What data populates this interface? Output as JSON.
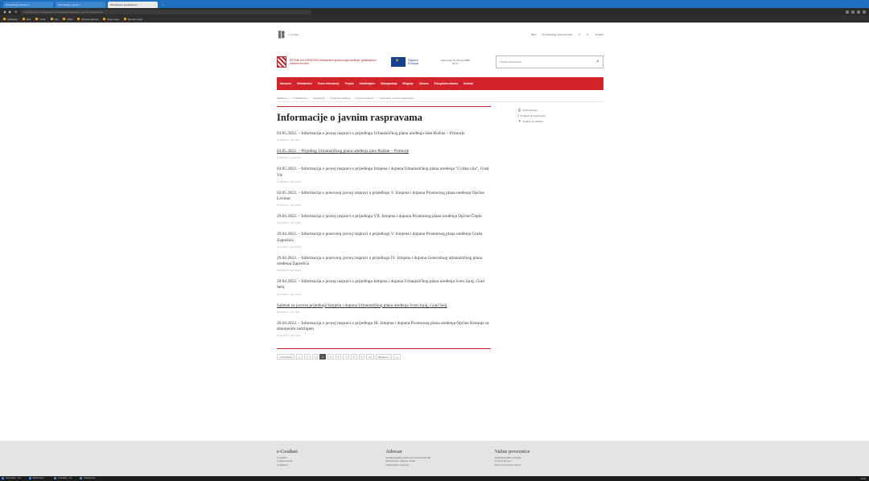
{
  "browser": {
    "tabs": [
      "Ministarstvo prostorno...",
      "Informacije o javnim...",
      "Ministarstvo graditeljstva..."
    ],
    "new_tab": "+",
    "url": "mgipu.gov.hr/o-ministarstvu/ministarstvo/informacije-o-javnim-raspravama",
    "bookmarks": [
      "Aplikacije",
      "Mail",
      "Vodič",
      "Kiki",
      "MMS",
      "Mreže knjižnica",
      "Moja mapa",
      "Moodle mapa"
    ]
  },
  "top": {
    "egradjani": "e-Građani",
    "links": [
      "RSS",
      "Pretraživanje pristupačnosti",
      "A",
      "A-",
      "English"
    ]
  },
  "header": {
    "ministry": "REPUBLIKA HRVATSKA Ministarstvo prostornoga uređenja, graditeljstva i državne imovine",
    "eu": "Sigurni Europa",
    "call": "Call centar za obnovu 0800 00 17",
    "search_placeholder": "Pretraži Ministarstvo"
  },
  "nav": [
    "Naslovna",
    "Ministarstvo",
    "Pravo informacije",
    "Propisi",
    "Graditeljstvo",
    "Stanogradnja",
    "Mingorje",
    "Obnova",
    "Energetska obnova",
    "Kontakt"
  ],
  "breadcrumb": [
    "Naslovna",
    "O Ministarstvu",
    "Djelatnosti",
    "Prostorno uređenje",
    "Prostorni planovi",
    "Informacije o javnim raspravama"
  ],
  "sidebar": [
    "Ispiši stranicu",
    "Podijeli na Facebooku",
    "Podijeli na Twitteru"
  ],
  "page_title": "Informacije o javnim raspravama",
  "articles": [
    {
      "title": "03.05.2022. – Informacija o javnoj raspravi o prijedlogu Urbanističkog plana uređenja luke Rožine – Primorje",
      "meta": "03.05.2022. | pdf 1 Mb",
      "linked": false
    },
    {
      "title": "03.05.2022. – Prijedlog Urbanističkog plana uređenja luke Rožine – Primorje",
      "meta": "03.05.2022. | poveznica",
      "linked": true
    },
    {
      "title": "03.05.2022. – Informacija o javnoj raspravi o prijedlogu Izmjena i dopuna Urbanističkog plana uređenja \"Cvitka vila\", Grad Vis",
      "meta": "03.05.2022. | pdf 218 kb",
      "linked": false
    },
    {
      "title": "02.05.2022. – Informacija o ponovnoj javnoj raspravi o prijedlogu V. Izmjena i dopuna Prostornog plana uređenja Općine Lovinac",
      "meta": "02.05.2022. | pdf 219 kb",
      "linked": false
    },
    {
      "title": "29.04.2022. – Informacija o javnoj raspravi o prijedlogu VII. Izmjena i dopuna Prostornog plana uređenja Općine Čepin",
      "meta": "29.04.2022. | pdf 218 kb",
      "linked": false
    },
    {
      "title": "29.04.2022. – Informacija o ponovnoj javnoj raspravi o prijedlogu V. Izmjena i dopuna Prostornog plana uređenja Grada Zaprešića",
      "meta": "29.04.2022. | pdf 217 kb",
      "linked": false
    },
    {
      "title": "29.04.2022. – Informacija o ponovnoj javnoj raspravi o prijedlogu IV. Izmjena i dopuna Generalnog urbanističkog plana uređenja Zaprešića",
      "meta": "29.04.2022. | pdf 218 kb",
      "linked": false
    },
    {
      "title": "29.04.2022. – Informacija o javnoj raspravi o prijedlogu Izmjena i dopuna Urbanističkog plana uređenja Sveti Juraj, Grad Senj",
      "meta": "29.04.2022. | pdf 216 kb",
      "linked": false
    },
    {
      "title": "Sažetak za javnost prijedloga Izmjena i dopuna Urbanističkog plana uređenja Sveti Juraj, Grad Senj",
      "meta": "29.04.2022. | pdf 1 Mb",
      "linked": true
    },
    {
      "title": "29.04.2022. – Informacija o javnoj raspravi o prijedlogu III. Izmjena i dopuna Prostornog plana uređenja Općine Kistanje sa smanjenim sadržajem",
      "meta": "29.04.2022. | pdf 218 kb",
      "linked": false
    }
  ],
  "pagination": [
    "« Prethodna",
    "1",
    "2",
    "3",
    "4",
    "5",
    "6",
    "7",
    "8",
    "9",
    "10",
    "Sljedeća »",
    "»»"
  ],
  "footer": [
    {
      "head": "e-Građani",
      "links": [
        "e-Građani",
        "e-Savjetovanja",
        "e-Oglasna"
      ]
    },
    {
      "head": "Adresar",
      "links": [
        "Središnji katalog službenih dokumenata RH",
        "Ministarstva i državne službe",
        "Ostala tijela i ustanove"
      ]
    },
    {
      "head": "Važne poveznice",
      "links": [
        "Vlada Republike Hrvatske",
        "Fond za obnovu",
        "Zavod za prostorni razvoj"
      ]
    }
  ],
  "taskbar": {
    "tasks": [
      "Informacije - Go...",
      "Ministarstvo - ...",
      "e-Građani - Go...",
      "Ministarstvo - ..."
    ],
    "clock": "10:24"
  }
}
